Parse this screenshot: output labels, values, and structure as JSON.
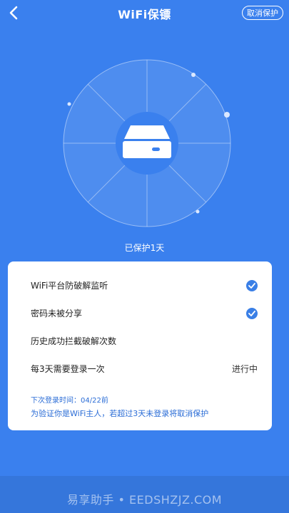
{
  "header": {
    "title": "WiFi保镖",
    "cancel_label": "取消保护"
  },
  "status_text": "已保护1天",
  "items": [
    {
      "label": "WiFi平台防破解监听",
      "status": "checked"
    },
    {
      "label": "密码未被分享",
      "status": "checked"
    },
    {
      "label": "历史成功拦截破解次数",
      "status": ""
    },
    {
      "label": "每3天需要登录一次",
      "status_text": "进行中"
    }
  ],
  "notes": {
    "next_login": "下次登录时间：04/22前",
    "warning": "为验证你是WiFi主人，若超过3天未登录将取消保护"
  },
  "watermark": "易享助手 • EEDSHZJZ.COM",
  "colors": {
    "background": "#3a80ee",
    "card": "#ffffff",
    "accent": "#3a7fe6",
    "note_text": "#2a6cd6"
  }
}
